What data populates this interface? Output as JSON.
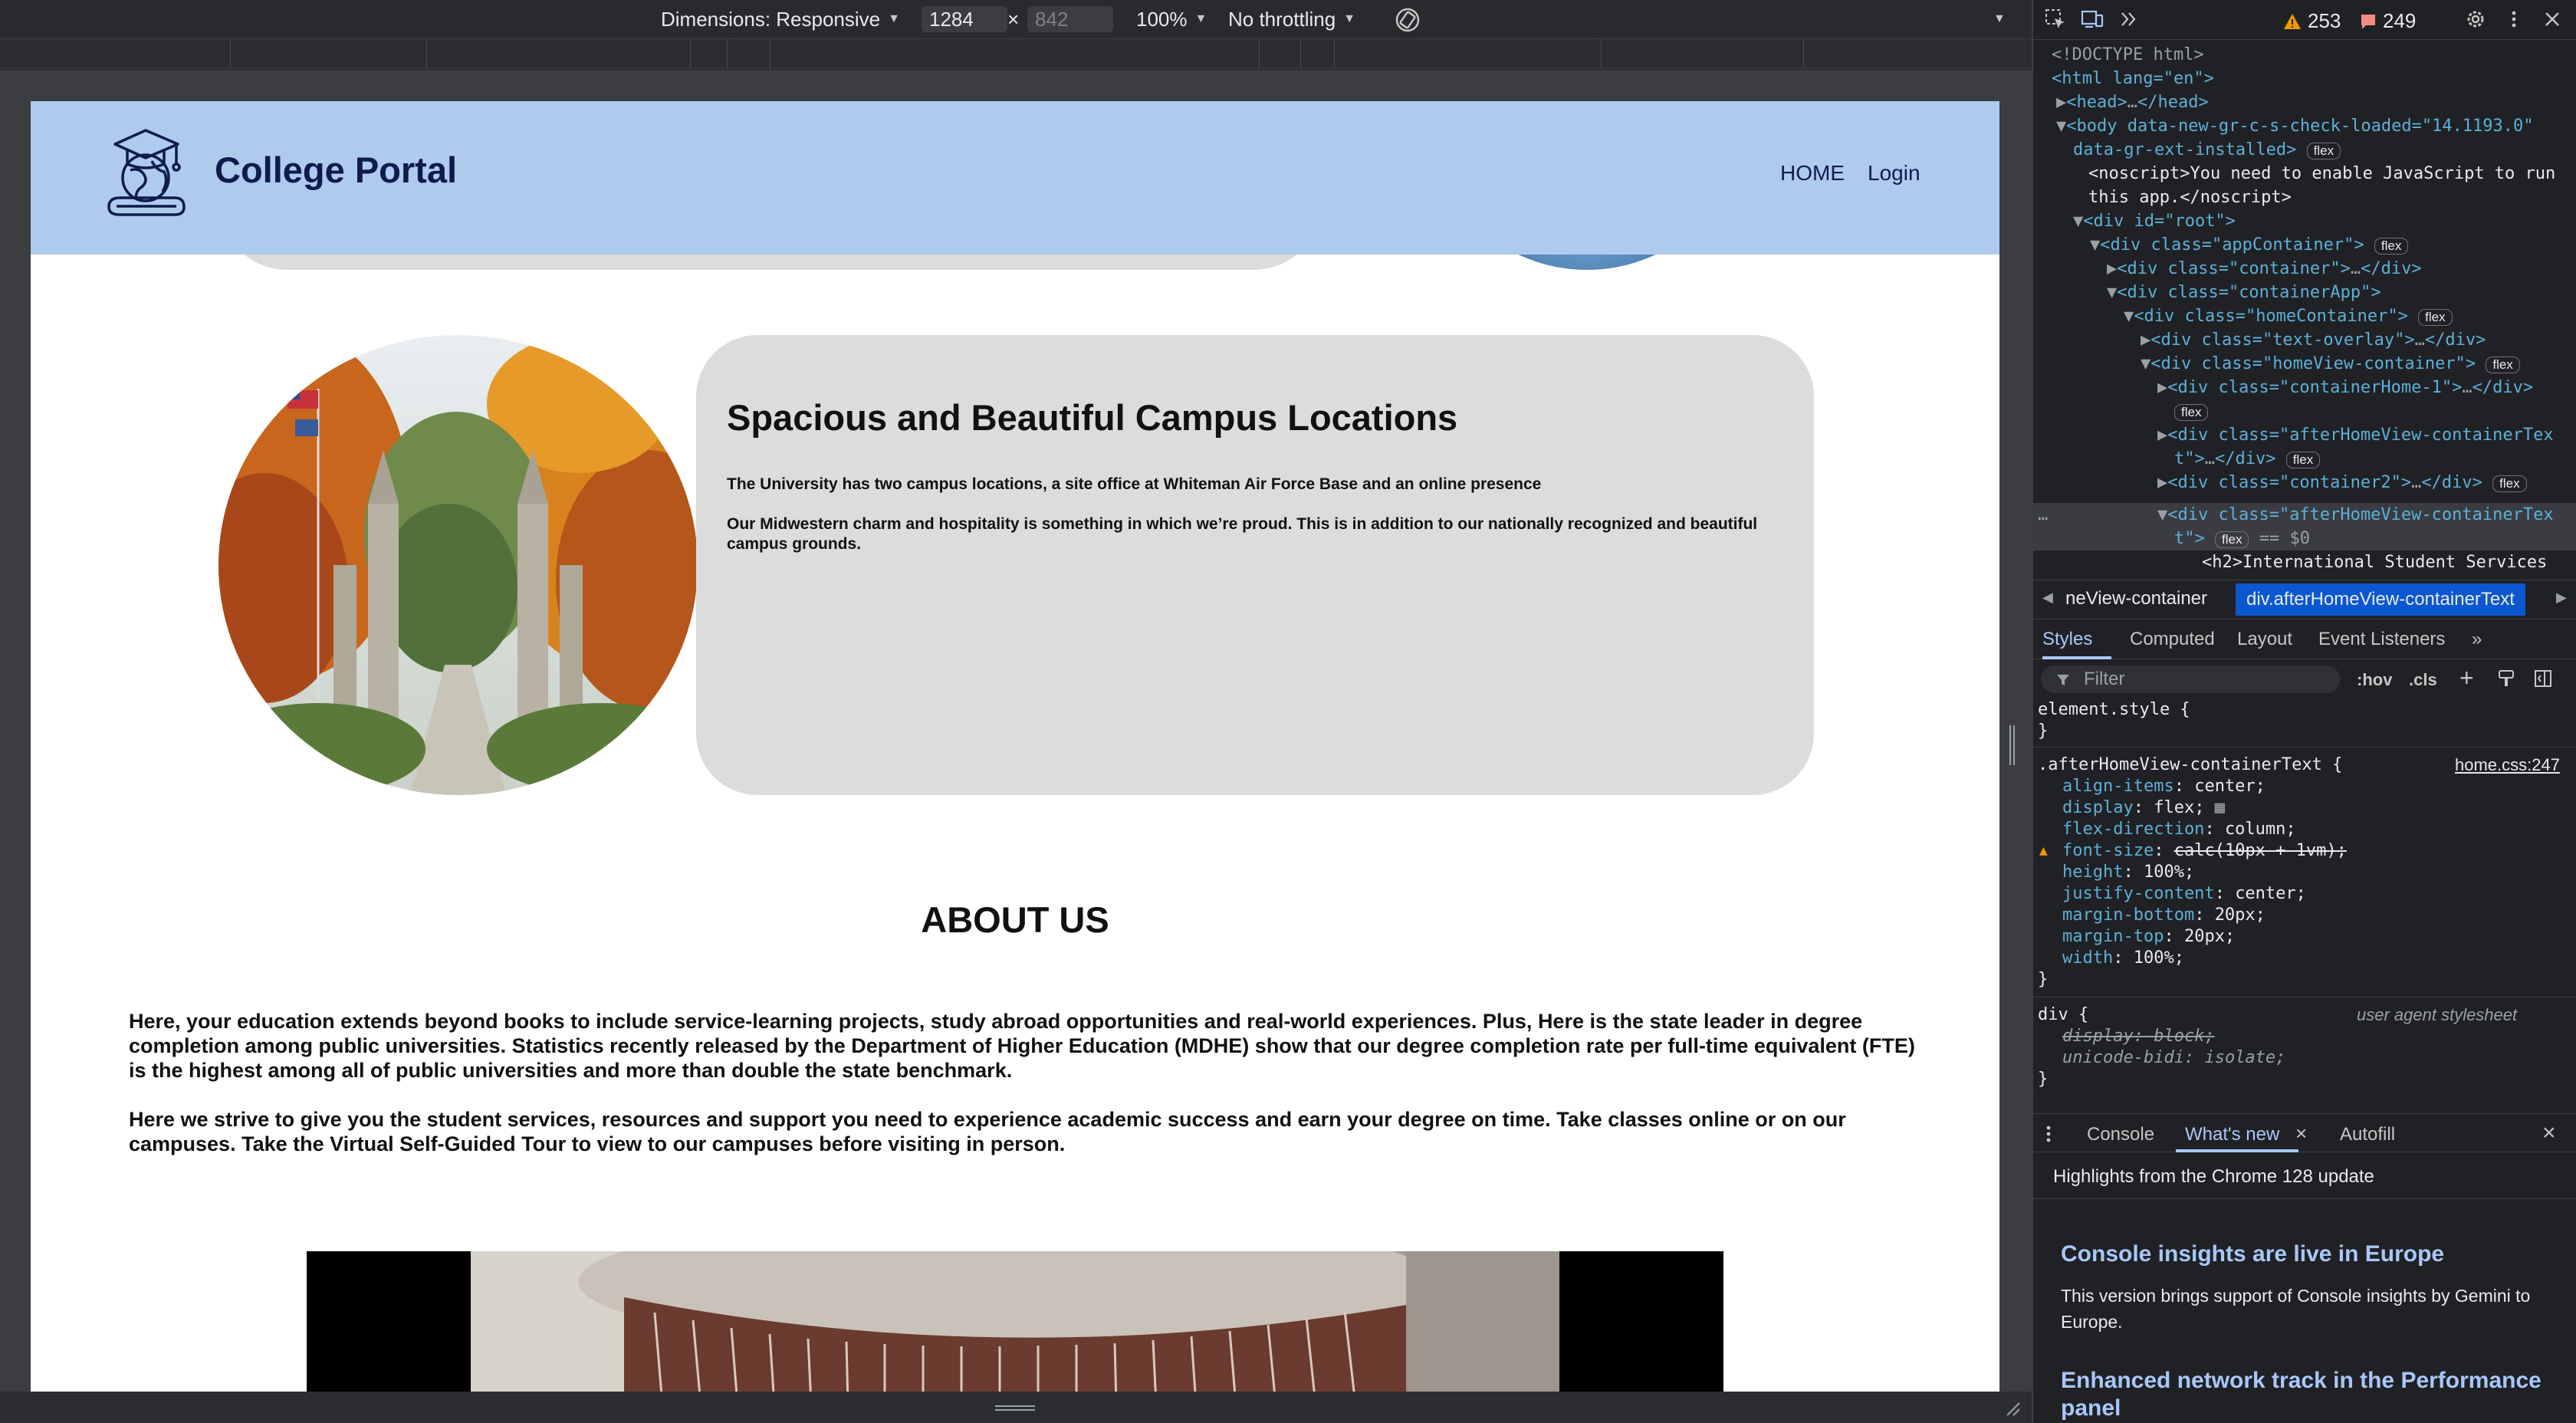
{
  "devbar": {
    "dimensions_label": "Dimensions: Responsive",
    "width_value": "1284",
    "height_value": "842",
    "zoom": "100%",
    "throttling": "No throttling",
    "times_symbol": "×"
  },
  "site": {
    "brand": "College Portal",
    "nav": {
      "home": "HOME",
      "login": "Login"
    },
    "campus": {
      "title": "Spacious and Beautiful Campus Locations",
      "p1": "The University has two campus locations, a site office at Whiteman Air Force Base and an online presence",
      "p2": "Our Midwestern charm and hospitality is something in which we’re proud. This is in addition to our nationally recognized and beautiful campus grounds."
    },
    "about": {
      "title": "ABOUT US",
      "p1": "Here, your education extends beyond books to include service-learning projects, study abroad opportunities and real-world experiences. Plus, Here is the state leader in degree completion among public universities. Statistics recently released by the Department of Higher Education (MDHE) show that our degree completion rate per full-time equivalent (FTE) is the highest among all of public universities and more than double the state benchmark.",
      "p2": "Here we strive to give you the student services, resources and support you need to experience academic success and earn your degree on time. Take classes online or on our campuses. Take the Virtual Self-Guided Tour to view to our campuses before visiting in person."
    }
  },
  "devtools": {
    "warnings": "253",
    "issues": "249",
    "dom": {
      "doctype": "<!DOCTYPE html>",
      "html_open": "<html lang=\"en\">",
      "head": "<head>",
      "head_close": "</head>",
      "body1": "<body data-new-gr-c-s-check-loaded=\"14.1193.0\"",
      "body2": "data-gr-ext-installed>",
      "noscript1": "<noscript>You need to enable JavaScript to run",
      "noscript2": "this app.</noscript>",
      "root": "<div id=\"root\">",
      "appContainer": "<div class=\"appContainer\">",
      "container": "<div class=\"container\">",
      "container_close": "</div>",
      "containerApp": "<div class=\"containerApp\">",
      "homeContainer": "<div class=\"homeContainer\">",
      "textOverlay": "<div class=\"text-overlay\">",
      "homeViewContainer": "<div class=\"homeView-container\">",
      "containerHome1": "<div class=\"containerHome-1\">",
      "afterHome1a": "<div class=\"afterHomeView-containerTex",
      "afterHome1b": "t\">",
      "container2": "<div class=\"container2\">",
      "afterHome2a": "<div class=\"afterHomeView-containerTex",
      "afterHome2b": "t\">",
      "selected_marker": "== $0",
      "h2": "<h2>International Student Services",
      "flex_badge": "flex"
    },
    "breadcrumbs": {
      "prev": "neView-container",
      "current": "div.afterHomeView-containerText"
    },
    "tabs": [
      "Styles",
      "Computed",
      "Layout",
      "Event Listeners"
    ],
    "filter_placeholder": "Filter",
    "hov": ":hov",
    "cls": ".cls",
    "styles": {
      "element_style": "element.style {",
      "close": "}",
      "selector": ".afterHomeView-containerText {",
      "source": "home.css:247",
      "props": [
        {
          "name": "align-items",
          "value": "center;"
        },
        {
          "name": "display",
          "value": "flex;"
        },
        {
          "name": "flex-direction",
          "value": "column;"
        },
        {
          "name": "font-size",
          "value": "calc(10px + 1vm);"
        },
        {
          "name": "height",
          "value": "100%;"
        },
        {
          "name": "justify-content",
          "value": "center;"
        },
        {
          "name": "margin-bottom",
          "value": "20px;"
        },
        {
          "name": "margin-top",
          "value": "20px;"
        },
        {
          "name": "width",
          "value": "100%;"
        }
      ],
      "div_selector": "div {",
      "ua_label": "user agent stylesheet",
      "ua_props": [
        {
          "name": "display",
          "value": "block;"
        },
        {
          "name": "unicode-bidi",
          "value": "isolate;"
        }
      ]
    },
    "drawer": {
      "tabs": [
        "Console",
        "What's new",
        "Autofill"
      ],
      "highlights": "Highlights from the Chrome 128 update",
      "h1": "Console insights are live in Europe",
      "p1": "This version brings support of Console insights by Gemini to Europe.",
      "h2": "Enhanced network track in the Performance panel"
    },
    "colors": {
      "accent": "#a8c7fa",
      "warning": "#f29900",
      "issue": "#f28b82"
    }
  }
}
